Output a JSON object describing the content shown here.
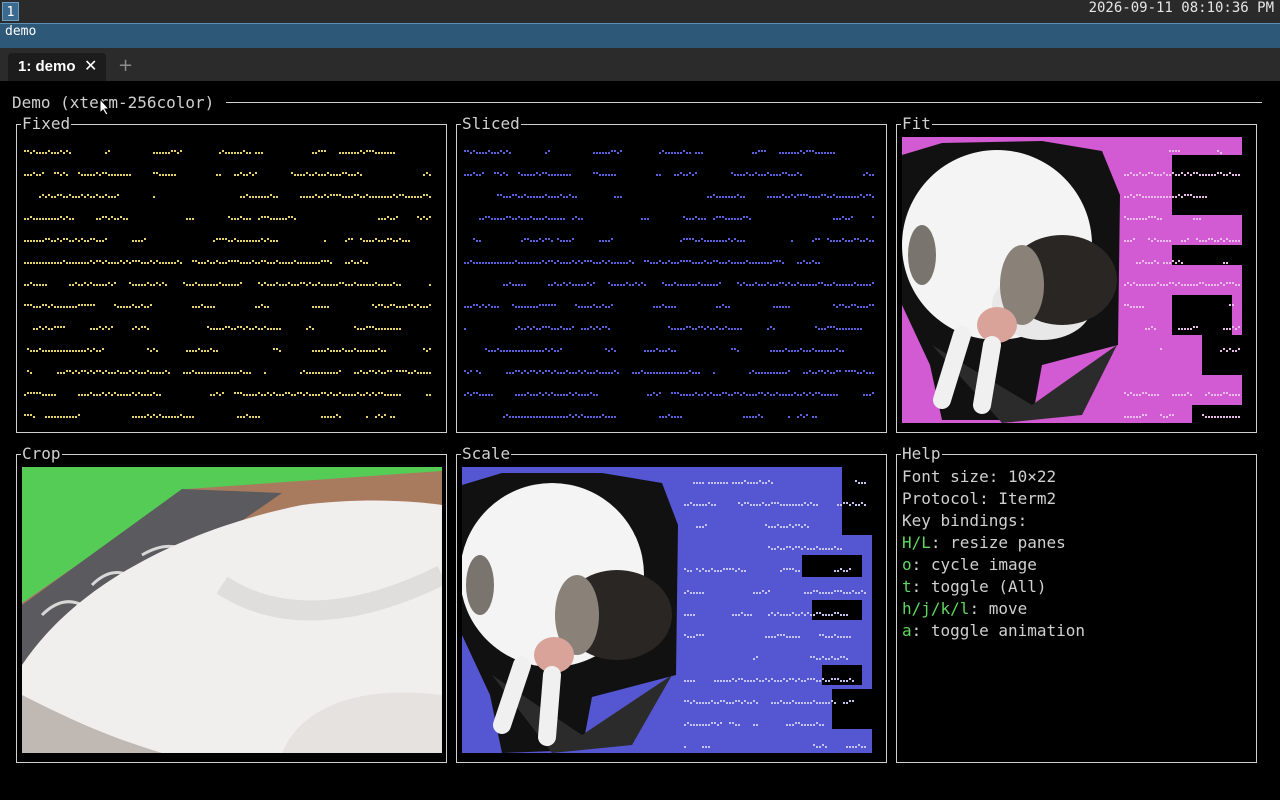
{
  "topbar": {
    "workspace": "1",
    "clock": "2026-09-11 08:10:36 PM"
  },
  "window": {
    "title": "demo"
  },
  "tabs": [
    {
      "label": "1: demo",
      "close": "✕"
    }
  ],
  "newtab": "+",
  "app": {
    "title": "Demo (xterm-256color)",
    "panels": {
      "fixed": "Fixed",
      "sliced": "Sliced",
      "fit": "Fit",
      "crop": "Crop",
      "scale": "Scale",
      "help": "Help"
    },
    "help": {
      "font_size": "Font size: 10×22",
      "protocol": "Protocol: Iterm2",
      "key_bindings": "Key bindings:",
      "bindings": [
        {
          "key": "H/L",
          "desc": ": resize panes"
        },
        {
          "key": "o",
          "desc": ": cycle image"
        },
        {
          "key": "t",
          "desc": ": toggle (All)"
        },
        {
          "key": "h/j/k/l",
          "desc": ": move"
        },
        {
          "key": "a",
          "desc": ": toggle animation"
        }
      ]
    }
  },
  "colors": {
    "dots_yellow": "#e6d36a",
    "dots_blue": "#5a5fe0",
    "fit_bg": "#d25ad2",
    "scale_bg": "#5556d2",
    "crop_bg": "#55cc55",
    "key_green": "#5fd75f"
  },
  "icons": {
    "close": "close-icon",
    "add": "add-icon",
    "cursor": "mouse-cursor-icon"
  }
}
